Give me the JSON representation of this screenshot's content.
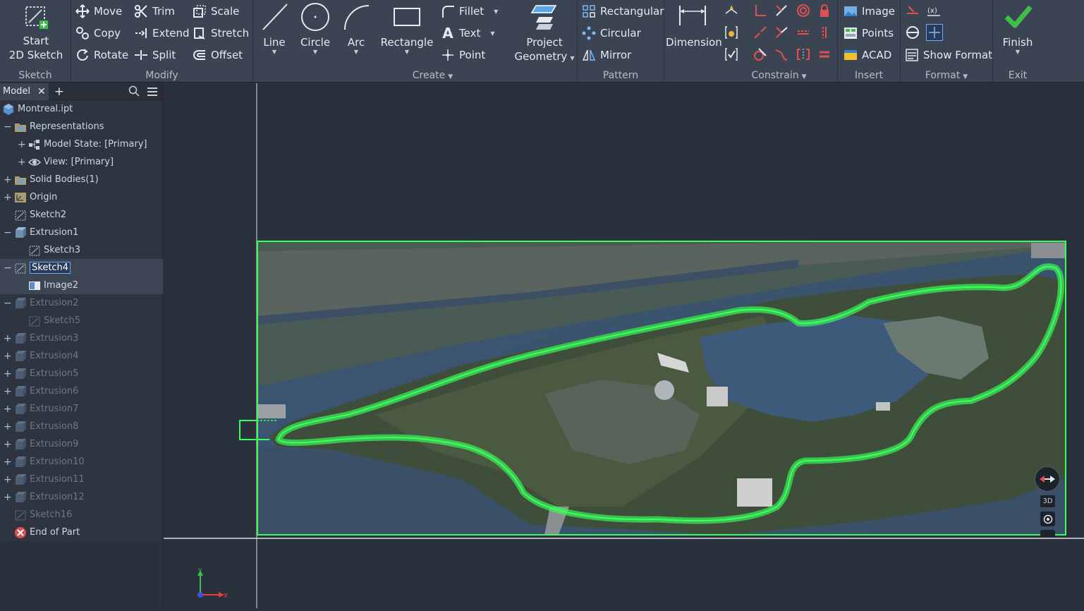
{
  "ribbon": {
    "sketch": {
      "start": "Start",
      "sketch2d": "2D Sketch",
      "title": "Sketch"
    },
    "modify": {
      "move": "Move",
      "trim": "Trim",
      "scale": "Scale",
      "copy": "Copy",
      "extend": "Extend",
      "stretch": "Stretch",
      "rotate": "Rotate",
      "split": "Split",
      "offset": "Offset",
      "title": "Modify"
    },
    "create": {
      "line": "Line",
      "circle": "Circle",
      "arc": "Arc",
      "rectangle": "Rectangle",
      "fillet": "Fillet",
      "text": "Text",
      "point": "Point",
      "title": "Create"
    },
    "project": {
      "line1": "Project",
      "line2": "Geometry"
    },
    "pattern": {
      "rectangular": "Rectangular",
      "circular": "Circular",
      "mirror": "Mirror",
      "title": "Pattern"
    },
    "constrain": {
      "dimension": "Dimension",
      "title": "Constrain"
    },
    "insert": {
      "image": "Image",
      "points": "Points",
      "acad": "ACAD",
      "title": "Insert"
    },
    "format": {
      "show_format": "Show Format",
      "title": "Format"
    },
    "exit": {
      "finish": "Finish",
      "title": "Exit"
    }
  },
  "browser": {
    "tab": "Model",
    "tree": [
      {
        "label": "Montreal.ipt",
        "icon": "part-icon"
      },
      {
        "label": "Representations",
        "icon": "folder-icon"
      },
      {
        "label": "Model State: [Primary]",
        "icon": "model-state-icon"
      },
      {
        "label": "View: [Primary]",
        "icon": "eye-icon"
      },
      {
        "label": "Solid Bodies(1)",
        "icon": "folder-icon"
      },
      {
        "label": "Origin",
        "icon": "origin-icon"
      },
      {
        "label": "Sketch2",
        "icon": "sketch-icon"
      },
      {
        "label": "Extrusion1",
        "icon": "extrusion-icon"
      },
      {
        "label": "Sketch3",
        "icon": "sketch-icon"
      },
      {
        "label": "Sketch4",
        "icon": "sketch-icon"
      },
      {
        "label": "Image2",
        "icon": "image-icon"
      },
      {
        "label": "Extrusion2",
        "icon": "extrusion-icon"
      },
      {
        "label": "Sketch5",
        "icon": "sketch-icon"
      },
      {
        "label": "Extrusion3",
        "icon": "extrusion-icon"
      },
      {
        "label": "Extrusion4",
        "icon": "extrusion-icon"
      },
      {
        "label": "Extrusion5",
        "icon": "extrusion-icon"
      },
      {
        "label": "Extrusion6",
        "icon": "extrusion-icon"
      },
      {
        "label": "Extrusion7",
        "icon": "extrusion-icon"
      },
      {
        "label": "Extrusion8",
        "icon": "extrusion-icon"
      },
      {
        "label": "Extrusion9",
        "icon": "extrusion-icon"
      },
      {
        "label": "Extrusion10",
        "icon": "extrusion-icon"
      },
      {
        "label": "Extrusion11",
        "icon": "extrusion-icon"
      },
      {
        "label": "Extrusion12",
        "icon": "extrusion-icon"
      },
      {
        "label": "Sketch16",
        "icon": "sketch-icon"
      },
      {
        "label": "End of Part",
        "icon": "end-of-part-icon"
      }
    ]
  },
  "viewcube": {
    "mode": "3D"
  },
  "triad": {
    "x": "X",
    "y": "Y"
  },
  "colors": {
    "sketch_green": "#39ff5a",
    "ribbon_bg": "#3b4453",
    "canvas_bg": "#2b313c",
    "water": "#3d5570"
  }
}
